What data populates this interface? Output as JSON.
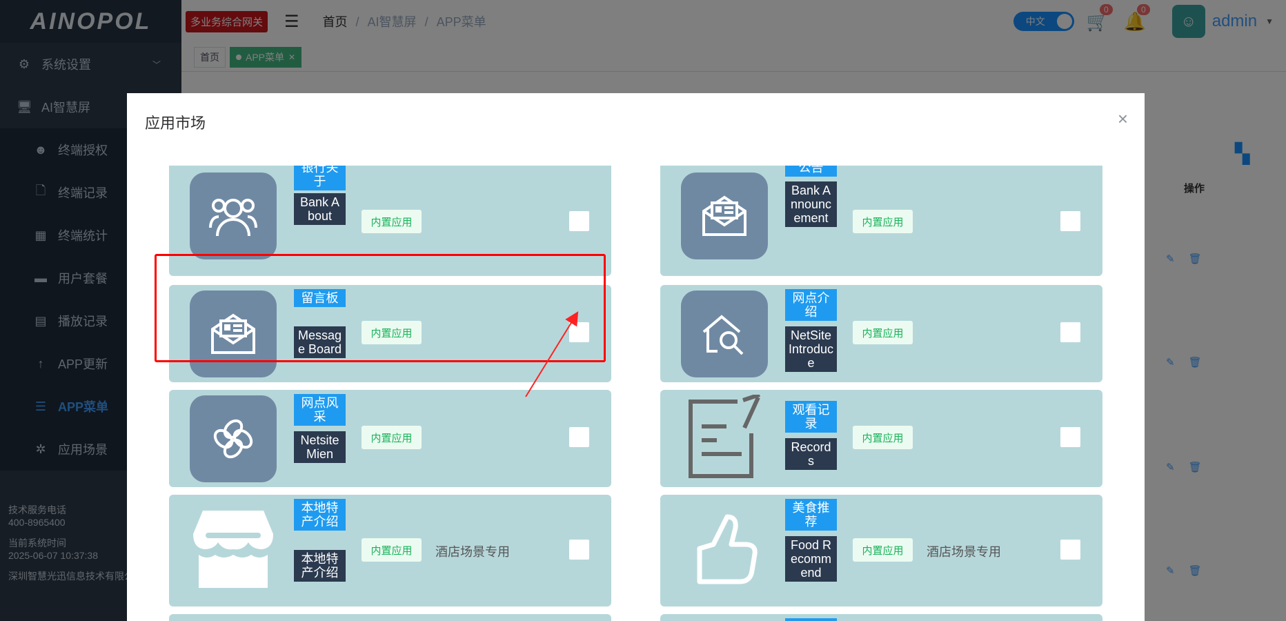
{
  "sidebar": {
    "logo": "AINOPOL",
    "top_items": [
      {
        "label": "系统设置",
        "icon": "gear-icon"
      },
      {
        "label": "AI智慧屏",
        "icon": "monitor-icon"
      }
    ],
    "sub_items": [
      {
        "label": "终端授权",
        "icon": "robot-icon"
      },
      {
        "label": "终端记录",
        "icon": "file-icon"
      },
      {
        "label": "终端统计",
        "icon": "calendar-icon"
      },
      {
        "label": "用户套餐",
        "icon": "wallet-icon"
      },
      {
        "label": "播放记录",
        "icon": "document-icon"
      },
      {
        "label": "APP更新",
        "icon": "arrow-up-icon"
      },
      {
        "label": "APP菜单",
        "icon": "list-icon",
        "active": true
      },
      {
        "label": "应用场景",
        "icon": "pinwheel-icon"
      }
    ],
    "footer": {
      "phone_label": "技术服务电话",
      "phone": "400-8965400",
      "time_label": "当前系统时间",
      "time": "2025-06-07 10:37:38",
      "company": "深圳智慧光迅信息技术有限公司"
    }
  },
  "header": {
    "gateway_badge": "多业务综合网关",
    "breadcrumb": [
      "首页",
      "AI智慧屏",
      "APP菜单"
    ],
    "lang": "中文",
    "cart_count": "0",
    "bell_count": "0",
    "username": "admin"
  },
  "tags": {
    "home": "首页",
    "active": "APP菜单"
  },
  "bg_table": {
    "ops_header": "操作"
  },
  "modal": {
    "title": "应用市场",
    "close": "×",
    "builtin_label": "内置应用",
    "cards": [
      {
        "cn": "银行关于",
        "en": "Bank About",
        "icon": "people-icon",
        "scene": ""
      },
      {
        "cn": "公告",
        "en": "Bank Announcement",
        "icon": "mail-icon",
        "scene": ""
      },
      {
        "cn": "留言板",
        "en": "Message Board",
        "icon": "mail-icon",
        "scene": ""
      },
      {
        "cn": "网点介绍",
        "en": "NetSite Introduce",
        "icon": "house-search-icon",
        "scene": ""
      },
      {
        "cn": "网点风采",
        "en": "Netsite Mien",
        "icon": "clover-icon",
        "scene": ""
      },
      {
        "cn": "观看记录",
        "en": "Records",
        "icon": "edit-icon",
        "scene": ""
      },
      {
        "cn": "本地特产介绍",
        "en": "本地特产介绍",
        "icon": "shop-icon",
        "scene": "酒店场景专用"
      },
      {
        "cn": "美食推荐",
        "en": "Food Recommend",
        "icon": "thumbs-up-icon",
        "scene": "酒店场景专用"
      }
    ]
  },
  "colors": {
    "card_bg": "#b6d7da",
    "icon_bg": "#7089a3",
    "label_cn_bg": "#1e9bf0",
    "label_en_bg": "#2b3a4f",
    "highlight": "#ff0000"
  }
}
